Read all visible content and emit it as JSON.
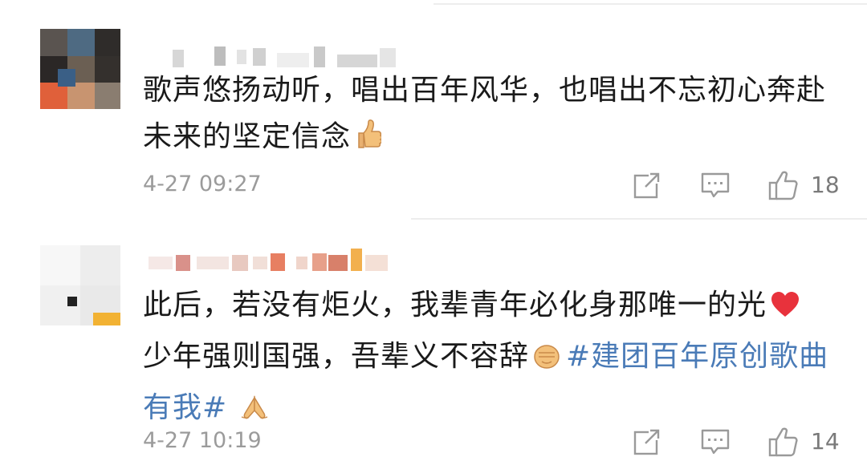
{
  "comments": [
    {
      "text": "歌声悠扬动听，唱出百年风华，也唱出不忘初心奔赴未来的坚定信念",
      "emoji_icon": "thumbs-up-emoji",
      "timestamp": "4-27 09:27",
      "like_count": "18"
    },
    {
      "text": "此后，若没有炬火，我辈青年必化身那唯一的光",
      "emoji_icon_1": "red-heart-emoji",
      "text_2": "少年强则国强，吾辈义不容辞",
      "emoji_icon_2": "raised-fist-emoji",
      "hashtag": "#建团百年原创歌曲有我#",
      "emoji_icon_3": "folded-hands-emoji",
      "timestamp": "4-27 10:19",
      "like_count": "14"
    }
  ],
  "actions": {
    "share_icon": "share-icon",
    "comment_icon": "comment-icon",
    "like_icon": "like-icon"
  },
  "colors": {
    "hashtag": "#4a7bb7",
    "meta": "#9b9b9b",
    "heart": "#e8323c",
    "emoji_skin": "#f3c07a"
  }
}
